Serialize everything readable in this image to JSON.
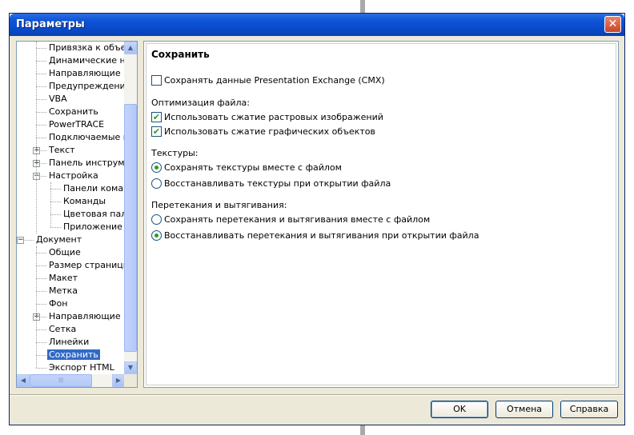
{
  "window": {
    "title": "Параметры",
    "close_glyph": "✕"
  },
  "tree": {
    "items": [
      {
        "label": "Привязка к объектам",
        "level": 2,
        "expander": "",
        "selected": false
      },
      {
        "label": "Динамические направляющие",
        "level": 2,
        "expander": "",
        "selected": false
      },
      {
        "label": "Направляющие",
        "level": 2,
        "expander": "",
        "selected": false
      },
      {
        "label": "Предупреждения",
        "level": 2,
        "expander": "",
        "selected": false
      },
      {
        "label": "VBA",
        "level": 2,
        "expander": "",
        "selected": false
      },
      {
        "label": "Сохранить",
        "level": 2,
        "expander": "",
        "selected": false
      },
      {
        "label": "PowerTRACE",
        "level": 2,
        "expander": "",
        "selected": false
      },
      {
        "label": "Подключаемые модули",
        "level": 2,
        "expander": "",
        "selected": false
      },
      {
        "label": "Текст",
        "level": 2,
        "expander": "+",
        "selected": false
      },
      {
        "label": "Панель инструментов",
        "level": 2,
        "expander": "+",
        "selected": false
      },
      {
        "label": "Настройка",
        "level": 2,
        "expander": "−",
        "selected": false
      },
      {
        "label": "Панели команд",
        "level": 3,
        "expander": "",
        "selected": false
      },
      {
        "label": "Команды",
        "level": 3,
        "expander": "",
        "selected": false
      },
      {
        "label": "Цветовая палитра",
        "level": 3,
        "expander": "",
        "selected": false
      },
      {
        "label": "Приложение",
        "level": 3,
        "expander": "",
        "selected": false
      },
      {
        "label": "Документ",
        "level": 1,
        "expander": "−",
        "selected": false
      },
      {
        "label": "Общие",
        "level": 2,
        "expander": "",
        "selected": false
      },
      {
        "label": "Размер страницы",
        "level": 2,
        "expander": "",
        "selected": false
      },
      {
        "label": "Макет",
        "level": 2,
        "expander": "",
        "selected": false
      },
      {
        "label": "Метка",
        "level": 2,
        "expander": "",
        "selected": false
      },
      {
        "label": "Фон",
        "level": 2,
        "expander": "",
        "selected": false
      },
      {
        "label": "Направляющие",
        "level": 2,
        "expander": "+",
        "selected": false
      },
      {
        "label": "Сетка",
        "level": 2,
        "expander": "",
        "selected": false
      },
      {
        "label": "Линейки",
        "level": 2,
        "expander": "",
        "selected": false
      },
      {
        "label": "Сохранить",
        "level": 2,
        "expander": "",
        "selected": true
      },
      {
        "label": "Экспорт HTML",
        "level": 2,
        "expander": "",
        "selected": false
      }
    ],
    "scroll_up": "▲",
    "scroll_down": "▼",
    "scroll_left": "◀",
    "scroll_right": "▶",
    "hthumb_grip": "|||"
  },
  "panel": {
    "title": "Сохранить",
    "cmx_checkbox": {
      "label": "Сохранять данные Presentation Exchange (CMX)",
      "checked": false
    },
    "optimization_label": "Оптимизация файла:",
    "bitmap_compress": {
      "label": "Использовать сжатие растровых изображений",
      "checked": true
    },
    "graphic_compress": {
      "label": "Использовать сжатие графических объектов",
      "checked": true
    },
    "textures_label": "Текстуры:",
    "textures_save": {
      "label": "Сохранять текстуры вместе с файлом",
      "selected": true
    },
    "textures_restore": {
      "label": "Восстанавливать текстуры при открытии файла",
      "selected": false
    },
    "blends_label": "Перетекания и вытягивания:",
    "blends_save": {
      "label": "Сохранять перетекания и вытягивания вместе с файлом",
      "selected": false
    },
    "blends_restore": {
      "label": "Восстанавливать перетекания и вытягивания при открытии файла",
      "selected": true
    },
    "check_glyph": "✔"
  },
  "buttons": {
    "ok": "OK",
    "cancel": "Отмена",
    "help": "Справка"
  },
  "colors": {
    "titlebar": "#0848c8",
    "selection": "#316ac5",
    "accent_green": "#21a121"
  }
}
